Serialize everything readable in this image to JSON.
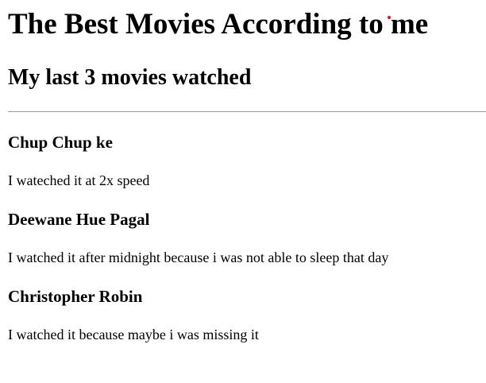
{
  "page": {
    "title": "The Best Movies According to me",
    "subtitle": "My last 3 movies watched"
  },
  "movies": [
    {
      "title": "Chup Chup ke",
      "note": "I wateched it at 2x speed"
    },
    {
      "title": "Deewane Hue Pagal",
      "note": "I watched it after midnight because i was not able to sleep that day"
    },
    {
      "title": "Christopher Robin",
      "note": "I watched it because maybe i was missing it"
    }
  ],
  "colors": {
    "text": "#000000",
    "background": "#ffffff",
    "divider": "#9a9a9a",
    "cursor_marker": "#d11a1a"
  }
}
